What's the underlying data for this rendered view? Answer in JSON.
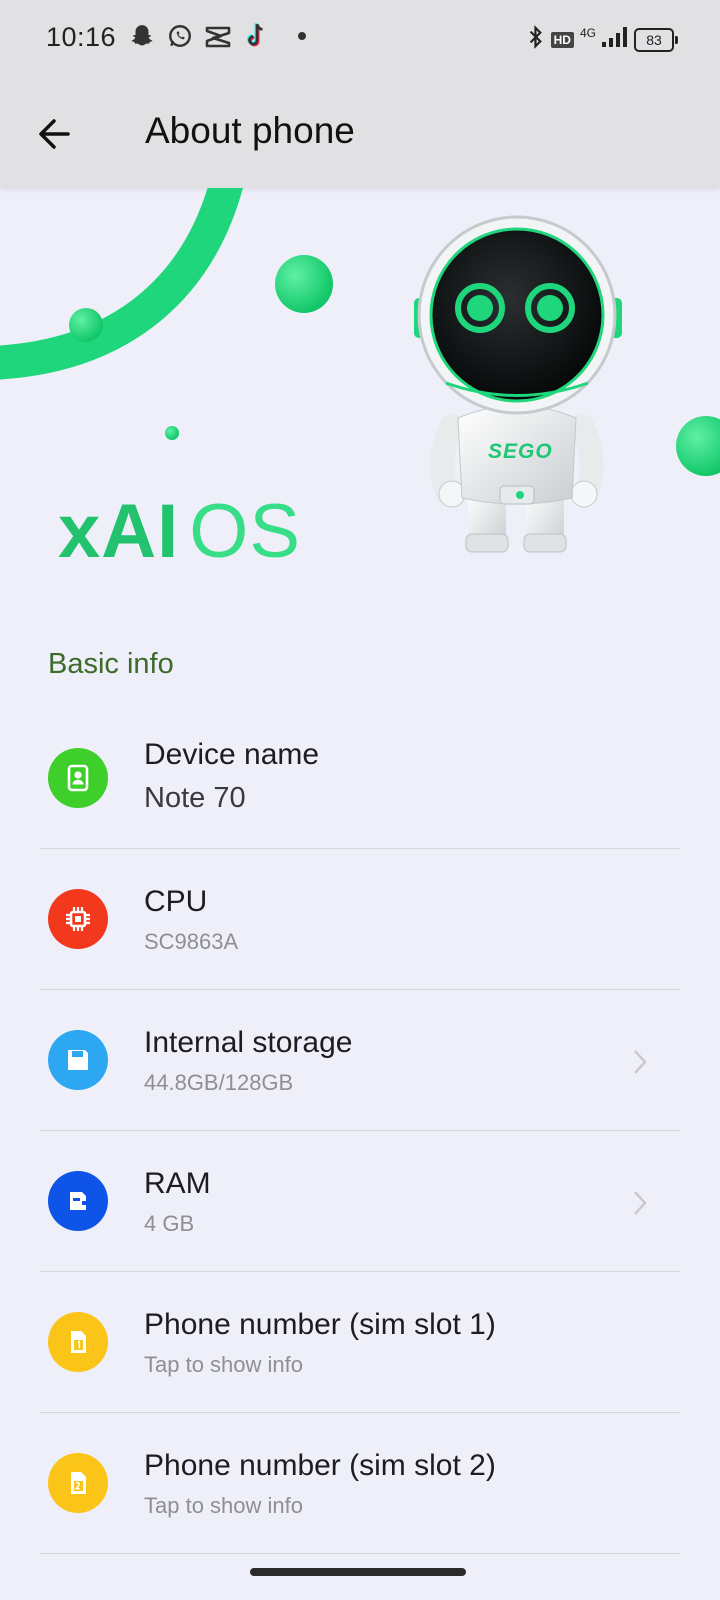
{
  "status_bar": {
    "time": "10:16",
    "notification_icons": [
      "snapchat-icon",
      "whatsapp-icon",
      "capcut-icon",
      "tiktok-icon"
    ],
    "right_icons": [
      "bluetooth-icon",
      "hd-icon",
      "network-4g-icon",
      "signal-icon"
    ],
    "hd_label": "HD",
    "network_label": "4G",
    "battery_level": "83"
  },
  "app_bar": {
    "title": "About phone",
    "back_icon": "arrow-left-icon"
  },
  "hero": {
    "brand_bold": "xAI",
    "brand_light": "OS",
    "mascot_chest_label": "SEGO",
    "accent_color": "#1fd67c"
  },
  "basic_info": {
    "section_title": "Basic info",
    "items": [
      {
        "title": "Device name",
        "subtitle": "Note 70",
        "icon": "contact-card-icon",
        "color": "#3fcf2b",
        "chevron": false
      },
      {
        "title": "CPU",
        "subtitle": "SC9863A",
        "icon": "chip-icon",
        "color": "#f2391e",
        "chevron": false
      },
      {
        "title": "Internal storage",
        "subtitle": "44.8GB/128GB",
        "icon": "floppy-disk-icon",
        "color": "#2ea7f2",
        "chevron": true
      },
      {
        "title": "RAM",
        "subtitle": "4 GB",
        "icon": "memory-card-icon",
        "color": "#0f54e8",
        "chevron": true
      },
      {
        "title": "Phone number (sim slot 1)",
        "subtitle": "Tap to show info",
        "icon": "sim-1-icon",
        "color": "#fbc418",
        "chevron": false
      },
      {
        "title": "Phone number (sim slot 2)",
        "subtitle": "Tap to show info",
        "icon": "sim-2-icon",
        "color": "#fbc418",
        "chevron": false
      }
    ]
  }
}
